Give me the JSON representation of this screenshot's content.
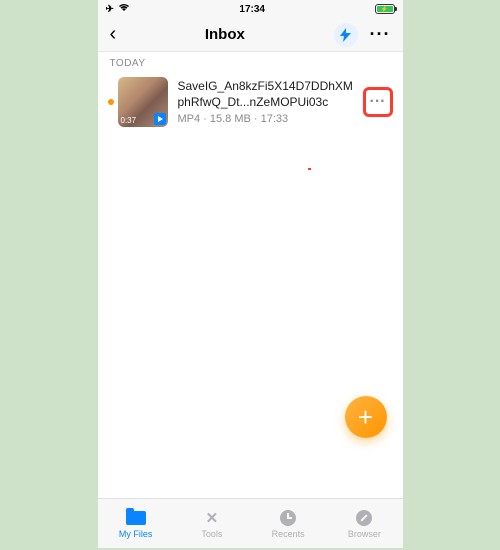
{
  "status": {
    "time": "17:34"
  },
  "nav": {
    "title": "Inbox"
  },
  "section": {
    "today": "TODAY"
  },
  "file": {
    "name": "SaveIG_An8kzFi5X14D7DDhXMphRfwQ_Dt...nZeMOPUi03c",
    "meta": "MP4  ·  15.8 MB  ·  17:33",
    "duration": "0:37"
  },
  "tabs": {
    "myfiles": "My Files",
    "tools": "Tools",
    "recents": "Recents",
    "browser": "Browser"
  }
}
